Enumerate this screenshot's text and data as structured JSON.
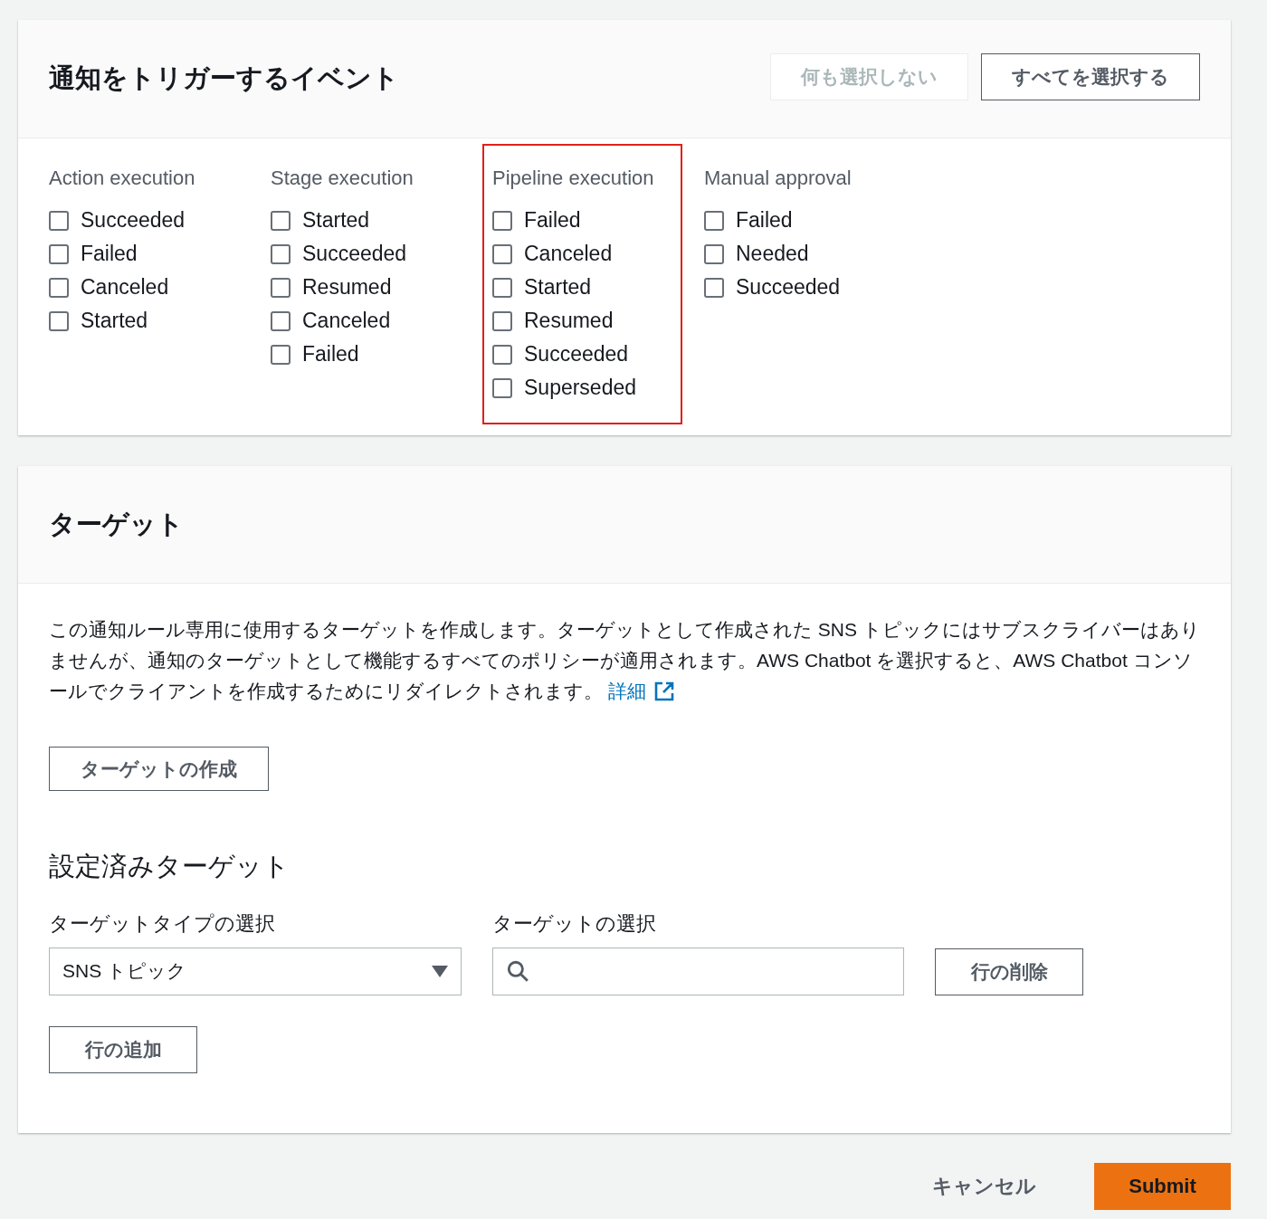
{
  "events": {
    "title": "通知をトリガーするイベント",
    "buttons": [
      {
        "label": "何も選択しない",
        "disabled": true
      },
      {
        "label": "すべてを選択する",
        "disabled": false
      }
    ],
    "groups": [
      {
        "title": "Action execution",
        "highlighted": false,
        "items": [
          {
            "label": "Succeeded",
            "checked": false
          },
          {
            "label": "Failed",
            "checked": false
          },
          {
            "label": "Canceled",
            "checked": false
          },
          {
            "label": "Started",
            "checked": false
          }
        ]
      },
      {
        "title": "Stage execution",
        "highlighted": false,
        "items": [
          {
            "label": "Started",
            "checked": false
          },
          {
            "label": "Succeeded",
            "checked": false
          },
          {
            "label": "Resumed",
            "checked": false
          },
          {
            "label": "Canceled",
            "checked": false
          },
          {
            "label": "Failed",
            "checked": false
          }
        ]
      },
      {
        "title": "Pipeline execution",
        "highlighted": true,
        "items": [
          {
            "label": "Failed",
            "checked": false
          },
          {
            "label": "Canceled",
            "checked": false
          },
          {
            "label": "Started",
            "checked": false
          },
          {
            "label": "Resumed",
            "checked": false
          },
          {
            "label": "Succeeded",
            "checked": false
          },
          {
            "label": "Superseded",
            "checked": false
          }
        ]
      },
      {
        "title": "Manual approval",
        "highlighted": false,
        "items": [
          {
            "label": "Failed",
            "checked": false
          },
          {
            "label": "Needed",
            "checked": false
          },
          {
            "label": "Succeeded",
            "checked": false
          }
        ]
      }
    ]
  },
  "targets": {
    "title": "ターゲット",
    "description": "この通知ルール専用に使用するターゲットを作成します。ターゲットとして作成された SNS トピックにはサブスクライバーはありませんが、通知のターゲットとして機能するすべてのポリシーが適用されます。AWS Chatbot を選択すると、AWS Chatbot コンソールでクライアントを作成するためにリダイレクトされます。",
    "link": "詳細",
    "create_button": "ターゲットの作成",
    "configured_title": "設定済みターゲット",
    "type_label": "ターゲットタイプの選択",
    "type_value": "SNS トピック",
    "target_label": "ターゲットの選択",
    "remove_button": "行の削除",
    "add_button": "行の追加"
  },
  "footer": {
    "cancel": "キャンセル",
    "submit": "Submit"
  }
}
